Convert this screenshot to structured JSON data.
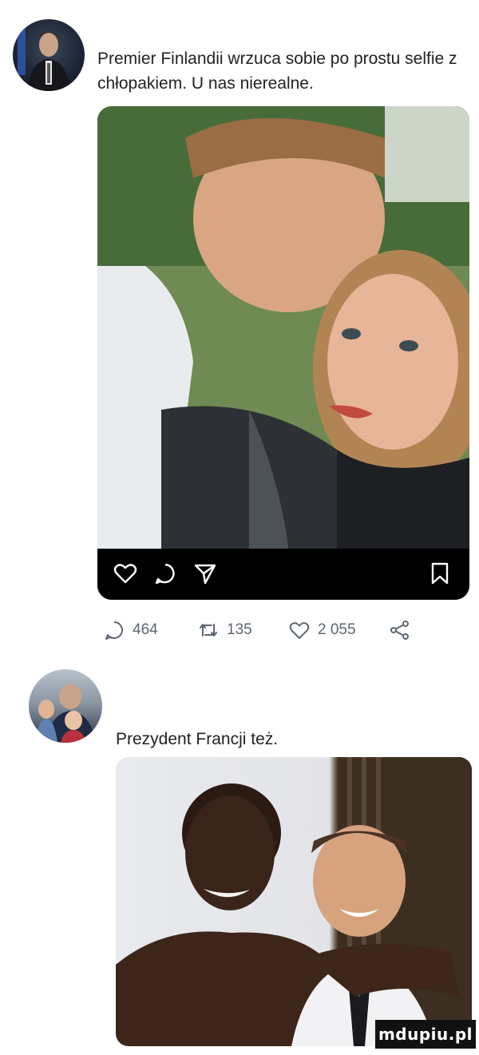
{
  "posts": [
    {
      "text": "Premier Finlandii wrzuca sobie po prostu selfie z chłopakiem. U nas nierealne.",
      "photo_bar_icons": [
        "heart-icon",
        "comment-icon",
        "share-icon",
        "bookmark-icon"
      ],
      "replies": "464",
      "retweets": "135",
      "likes": "2 055"
    },
    {
      "text": "Prezydent Francji też."
    }
  ],
  "watermark": "mdupiu.pl",
  "colors": {
    "text": "#222222",
    "action_gray": "#5d6670",
    "photo_bar": "#000000"
  }
}
